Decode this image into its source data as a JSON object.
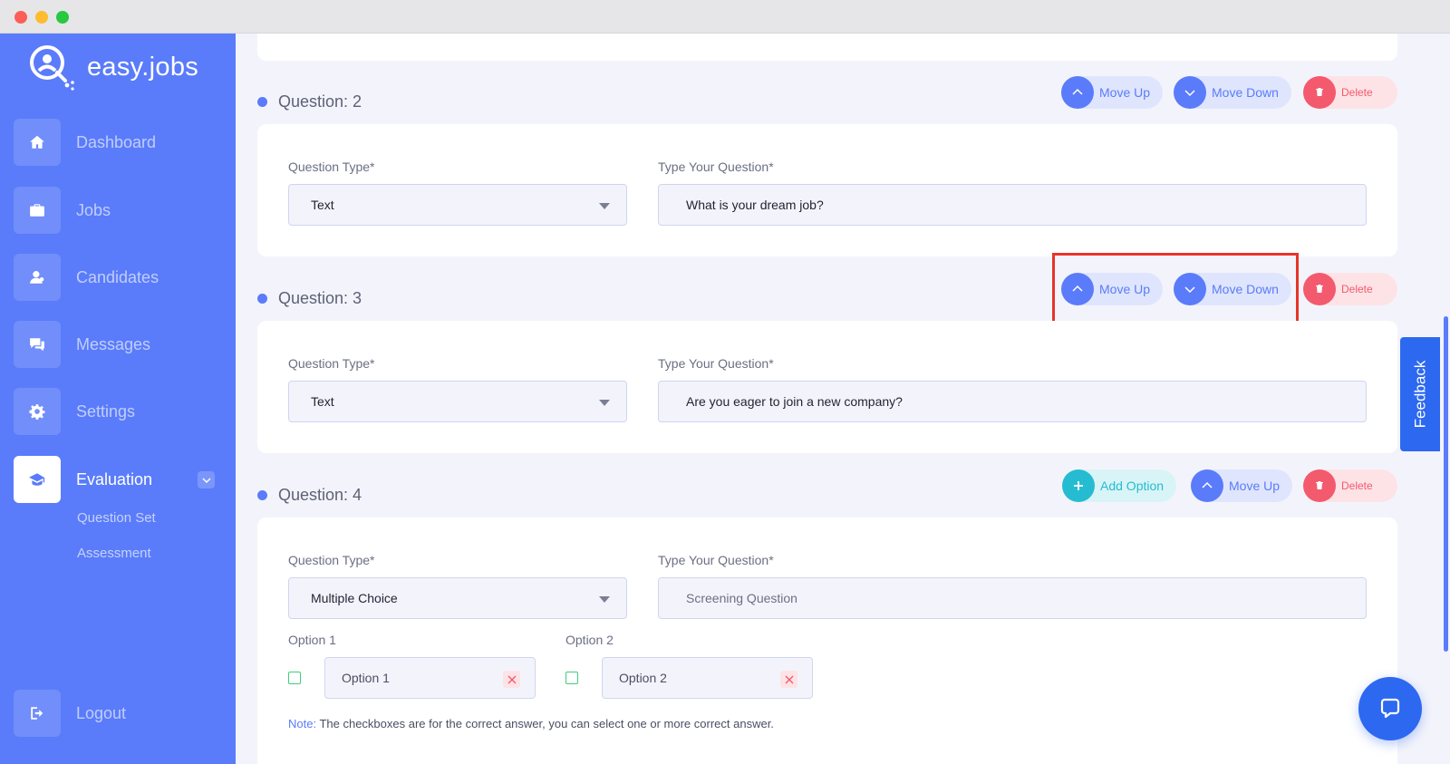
{
  "brand": {
    "name": "easy.jobs"
  },
  "sidebar": {
    "items": [
      {
        "label": "Dashboard",
        "icon": "home-icon"
      },
      {
        "label": "Jobs",
        "icon": "briefcase-icon"
      },
      {
        "label": "Candidates",
        "icon": "user-icon"
      },
      {
        "label": "Messages",
        "icon": "chat-icon"
      },
      {
        "label": "Settings",
        "icon": "gear-icon"
      },
      {
        "label": "Evaluation",
        "icon": "graduation-cap-icon",
        "active": true
      }
    ],
    "sub_items": [
      "Question Set",
      "Assessment"
    ],
    "logout": "Logout"
  },
  "buttons": {
    "move_up": "Move Up",
    "move_down": "Move Down",
    "delete": "Delete",
    "add_option": "Add Option"
  },
  "fields": {
    "type_label": "Question Type*",
    "question_label": "Type Your Question*"
  },
  "questions": [
    {
      "title": "Question: 2",
      "type": "Text",
      "question": "What is your dream job?"
    },
    {
      "title": "Question: 3",
      "type": "Text",
      "question": "Are you eager to join a new company?"
    },
    {
      "title": "Question: 4",
      "type": "Multiple Choice",
      "question_placeholder": "Screening Question",
      "options": [
        {
          "label": "Option 1",
          "value": "Option 1"
        },
        {
          "label": "Option 2",
          "value": "Option 2"
        }
      ],
      "note_key": "Note:",
      "note_text": " The checkboxes are for the correct answer, you can select one or more correct answer."
    }
  ],
  "feedback": "Feedback",
  "colors": {
    "primary": "#5a7cfa",
    "danger": "#f35a6e",
    "teal": "#25bcd2",
    "feedback": "#2d68f0",
    "highlight": "#e8342a"
  }
}
